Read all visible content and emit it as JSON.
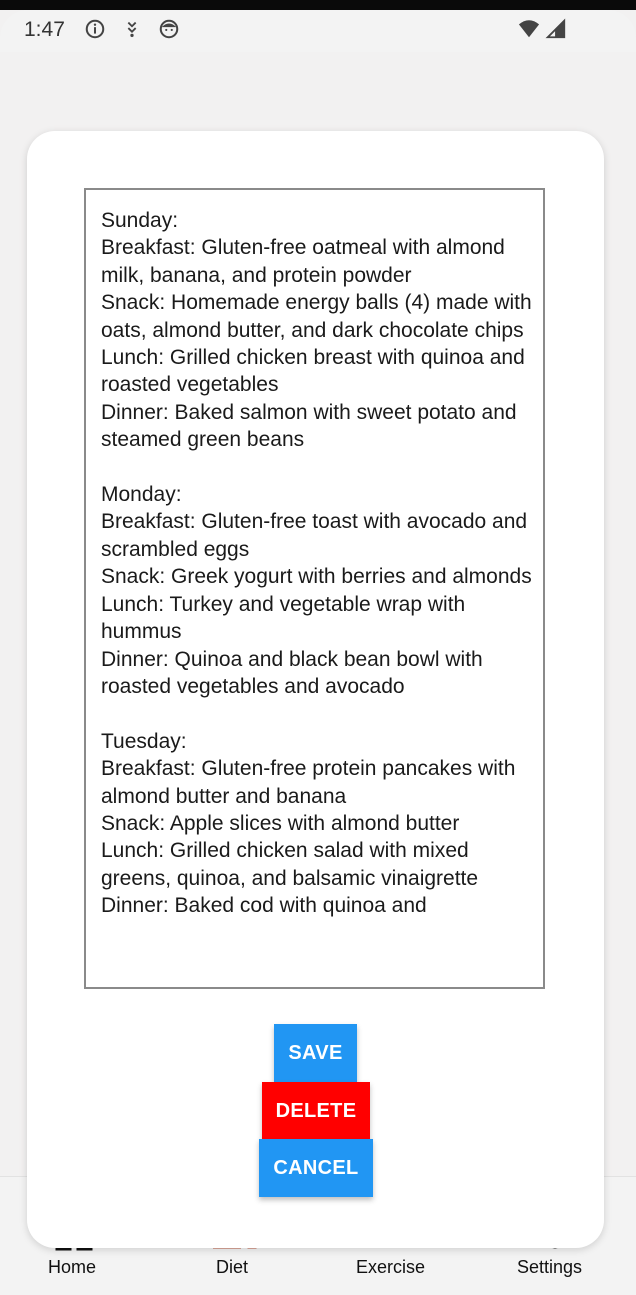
{
  "status_bar": {
    "time": "1:47",
    "icons": [
      "info-icon",
      "download-icon",
      "face-icon",
      "wifi-icon",
      "signal-icon"
    ]
  },
  "dialog": {
    "meal_plan_text": "Sunday:\nBreakfast: Gluten-free oatmeal with almond milk, banana, and protein powder\nSnack: Homemade energy balls (4) made with oats, almond butter, and dark chocolate chips\nLunch: Grilled chicken breast with quinoa and roasted vegetables\nDinner: Baked salmon with sweet potato and steamed green beans\n\nMonday:\nBreakfast: Gluten-free toast with avocado and scrambled eggs\nSnack: Greek yogurt with berries and almonds\nLunch: Turkey and vegetable wrap with hummus\nDinner: Quinoa and black bean bowl with roasted vegetables and avocado\n\nTuesday:\nBreakfast: Gluten-free protein pancakes with almond butter and banana\nSnack: Apple slices with almond butter\nLunch: Grilled chicken salad with mixed greens, quinoa, and balsamic vinaigrette\nDinner: Baked cod with quinoa and",
    "save_label": "SAVE",
    "delete_label": "DELETE",
    "cancel_label": "CANCEL"
  },
  "bottom_nav": {
    "items": [
      {
        "label": "Home",
        "icon": "home-icon"
      },
      {
        "label": "Diet",
        "icon": "diet-icon"
      },
      {
        "label": "Exercise",
        "icon": "exercise-icon"
      },
      {
        "label": "Settings",
        "icon": "settings-icon"
      }
    ]
  },
  "colors": {
    "primary_button": "#2196f3",
    "delete_button": "#ff0000",
    "diet_accent": "#c0573e"
  }
}
